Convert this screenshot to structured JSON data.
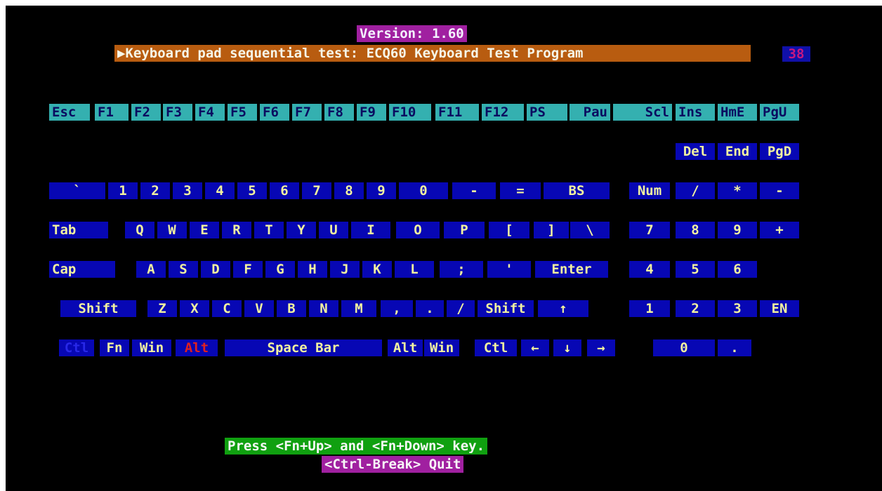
{
  "header": {
    "version": "Version: 1.60",
    "title": "▶Keyboard pad sequential test: ECQ60 Keyboard Test Program",
    "counter": "38"
  },
  "colors": {
    "key_blue": "#0707b4",
    "key_tested": "#34b0b0",
    "title_bg": "#b85c10",
    "version_bg": "#a020a0",
    "footer_green": "#10a010"
  },
  "keyboard": {
    "fn_row": [
      "Esc",
      "F1",
      "F2",
      "F3",
      "F4",
      "F5",
      "F6",
      "F7",
      "F8",
      "F9",
      "F10",
      "F11",
      "F12",
      "PS",
      "Pau",
      "Scl",
      "Ins",
      "HmE",
      "PgU"
    ],
    "nav_row": [
      "Del",
      "End",
      "PgD"
    ],
    "number_row": [
      "`",
      "1",
      "2",
      "3",
      "4",
      "5",
      "6",
      "7",
      "8",
      "9",
      "0",
      "-",
      "=",
      "BS",
      "Num",
      "/",
      "*",
      "-"
    ],
    "qwerty_row": [
      "Tab",
      "Q",
      "W",
      "E",
      "R",
      "T",
      "Y",
      "U",
      "I",
      "O",
      "P",
      "[",
      "]",
      "\\",
      "7",
      "8",
      "9",
      "+"
    ],
    "home_row": [
      "Cap",
      "A",
      "S",
      "D",
      "F",
      "G",
      "H",
      "J",
      "K",
      "L",
      ";",
      "'",
      "Enter",
      "4",
      "5",
      "6"
    ],
    "shift_row": [
      "Shift",
      "Z",
      "X",
      "C",
      "V",
      "B",
      "N",
      "M",
      ",",
      ".",
      "/",
      "Shift",
      "↑",
      "1",
      "2",
      "3",
      "EN"
    ],
    "bottom_row": [
      "Ctl",
      "Fn",
      "Win",
      "Alt",
      "Space Bar",
      "Alt",
      "Win",
      "Ctl",
      "←",
      "↓",
      "→",
      "0",
      "."
    ]
  },
  "footer": {
    "hint": "Press <Fn+Up> and <Fn+Down> key.",
    "quit": "<Ctrl-Break> Quit"
  }
}
